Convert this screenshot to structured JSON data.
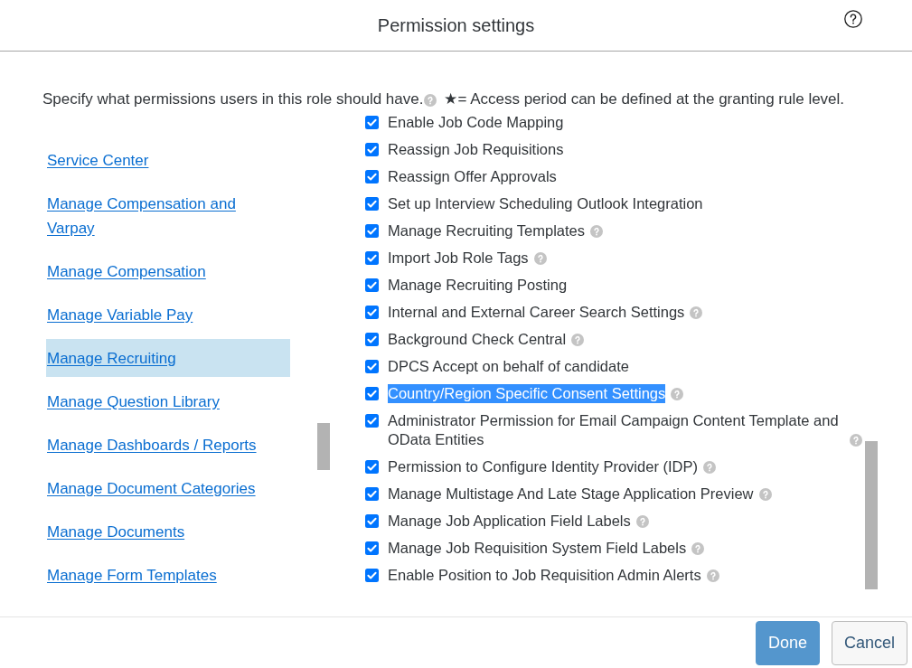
{
  "dialog": {
    "title": "Permission settings",
    "help": true
  },
  "description": {
    "text": "Specify what permissions users in this role should have.",
    "help": true,
    "legend": "★= Access period can be defined at the granting rule level."
  },
  "categories": [
    {
      "label": "Service Center",
      "selected": false
    },
    {
      "label": "Manage Compensation and Varpay",
      "selected": false
    },
    {
      "label": "Manage Compensation",
      "selected": false
    },
    {
      "label": "Manage Variable Pay",
      "selected": false
    },
    {
      "label": "Manage Recruiting",
      "selected": true
    },
    {
      "label": "Manage Question Library",
      "selected": false
    },
    {
      "label": "Manage Dashboards / Reports",
      "selected": false
    },
    {
      "label": "Manage Document Categories",
      "selected": false
    },
    {
      "label": "Manage Documents",
      "selected": false
    },
    {
      "label": "Manage Form Templates",
      "selected": false
    }
  ],
  "permissions": [
    {
      "label": "Enable Job Code Mapping",
      "checked": true,
      "help": false,
      "highlighted": false
    },
    {
      "label": "Reassign Job Requisitions",
      "checked": true,
      "help": false,
      "highlighted": false
    },
    {
      "label": "Reassign Offer Approvals",
      "checked": true,
      "help": false,
      "highlighted": false
    },
    {
      "label": "Set up Interview Scheduling Outlook Integration",
      "checked": true,
      "help": false,
      "highlighted": false
    },
    {
      "label": "Manage Recruiting Templates",
      "checked": true,
      "help": true,
      "highlighted": false
    },
    {
      "label": "Import Job Role Tags",
      "checked": true,
      "help": true,
      "highlighted": false
    },
    {
      "label": "Manage Recruiting Posting",
      "checked": true,
      "help": false,
      "highlighted": false
    },
    {
      "label": "Internal and External Career Search Settings",
      "checked": true,
      "help": true,
      "highlighted": false
    },
    {
      "label": "Background Check Central",
      "checked": true,
      "help": true,
      "highlighted": false
    },
    {
      "label": "DPCS Accept on behalf of candidate",
      "checked": true,
      "help": false,
      "highlighted": false
    },
    {
      "label": "Country/Region Specific Consent Settings",
      "checked": true,
      "help": true,
      "highlighted": true
    },
    {
      "label": "Administrator Permission for Email Campaign Content Template and OData Entities",
      "checked": true,
      "help": true,
      "highlighted": false
    },
    {
      "label": "Permission to Configure Identity Provider (IDP)",
      "checked": true,
      "help": true,
      "highlighted": false
    },
    {
      "label": "Manage Multistage And Late Stage Application Preview",
      "checked": true,
      "help": true,
      "highlighted": false
    },
    {
      "label": "Manage Job Application Field Labels",
      "checked": true,
      "help": true,
      "highlighted": false
    },
    {
      "label": "Manage Job Requisition System Field Labels",
      "checked": true,
      "help": true,
      "highlighted": false
    },
    {
      "label": "Enable Position to Job Requisition Admin Alerts",
      "checked": true,
      "help": true,
      "highlighted": false
    }
  ],
  "buttons": [
    {
      "label": "Done",
      "kind": "primary"
    },
    {
      "label": "Cancel",
      "kind": "secondary"
    }
  ]
}
